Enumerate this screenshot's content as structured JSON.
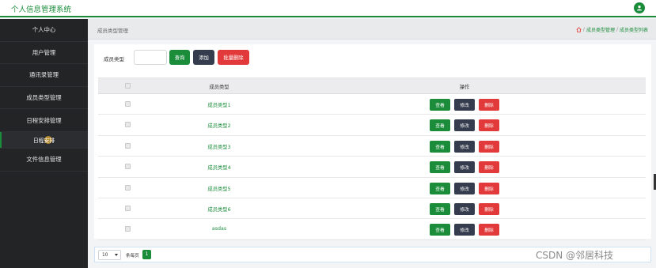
{
  "app": {
    "title": "个人信息管理系统",
    "accent_color": "#1a8c3a",
    "user_icon": "user-icon"
  },
  "sidebar": {
    "items": [
      {
        "label": "个人中心"
      },
      {
        "label": "用户管理"
      },
      {
        "label": "通讯录管理"
      },
      {
        "label": "成员类型管理"
      },
      {
        "label": "日程安排管理"
      },
      {
        "label": "日程安排",
        "active": true
      },
      {
        "label": "文件信息管理"
      }
    ]
  },
  "header": {
    "page_title": "成员类型管理",
    "breadcrumb": [
      "成员类型管理",
      "成员类型列表"
    ],
    "separator": "/",
    "home_icon": "home-icon"
  },
  "search": {
    "label": "成员类型",
    "value": "",
    "query_label": "查询",
    "add_label": "添加",
    "batch_delete_label": "批量删除"
  },
  "table": {
    "columns": [
      "成员类型",
      "操作"
    ],
    "rows": [
      {
        "name": "成员类型1"
      },
      {
        "name": "成员类型2"
      },
      {
        "name": "成员类型3"
      },
      {
        "name": "成员类型4"
      },
      {
        "name": "成员类型5"
      },
      {
        "name": "成员类型6"
      },
      {
        "name": "asdas"
      }
    ],
    "actions": {
      "view": "查看",
      "edit": "修改",
      "delete": "删除"
    }
  },
  "pagination": {
    "page_size": "10",
    "per_page_label": "条每页",
    "current_page": "1"
  },
  "watermark": "CSDN @邻居科技",
  "colors": {
    "green": "#1a8c3a",
    "dark": "#353c4d",
    "red": "#e23a3a",
    "sidebar": "#222426"
  }
}
